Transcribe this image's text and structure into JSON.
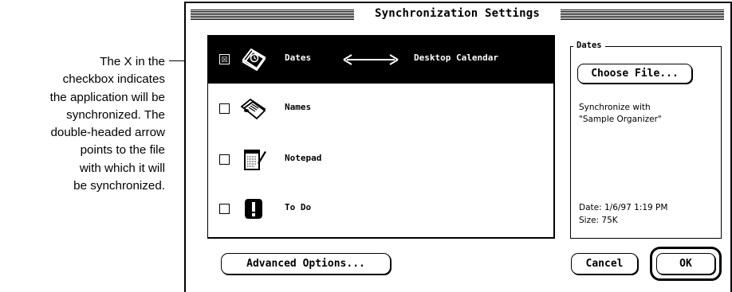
{
  "callout": {
    "lines": [
      "The X in the",
      "checkbox indicates",
      "the application will be",
      "synchronized. The",
      "double-headed arrow",
      "points to the file",
      "with which it will",
      "be synchronized."
    ]
  },
  "window": {
    "title": "Synchronization Settings"
  },
  "list": {
    "items": [
      {
        "label": "Dates",
        "checkbox": "☒",
        "target": "Desktop Calendar",
        "icon": "calendar-icon",
        "selected": true
      },
      {
        "label": "Names",
        "checkbox": "",
        "target": "",
        "icon": "address-cards-icon",
        "selected": false
      },
      {
        "label": "Notepad",
        "checkbox": "",
        "target": "",
        "icon": "notepad-icon",
        "selected": false
      },
      {
        "label": "To Do",
        "checkbox": "",
        "target": "",
        "icon": "exclamation-icon",
        "selected": false
      }
    ]
  },
  "details": {
    "legend": "Dates",
    "choose_file": "Choose File...",
    "sync_line1": "Synchronize with",
    "sync_line2": "\"Sample Organizer\"",
    "date": "Date: 1/6/97 1:19 PM",
    "size": "Size: 75K"
  },
  "buttons": {
    "advanced": "Advanced Options...",
    "cancel": "Cancel",
    "ok": "OK"
  },
  "colors": {
    "selection_bg": "#000000",
    "selection_fg": "#ffffff",
    "background": "#ffffff"
  }
}
